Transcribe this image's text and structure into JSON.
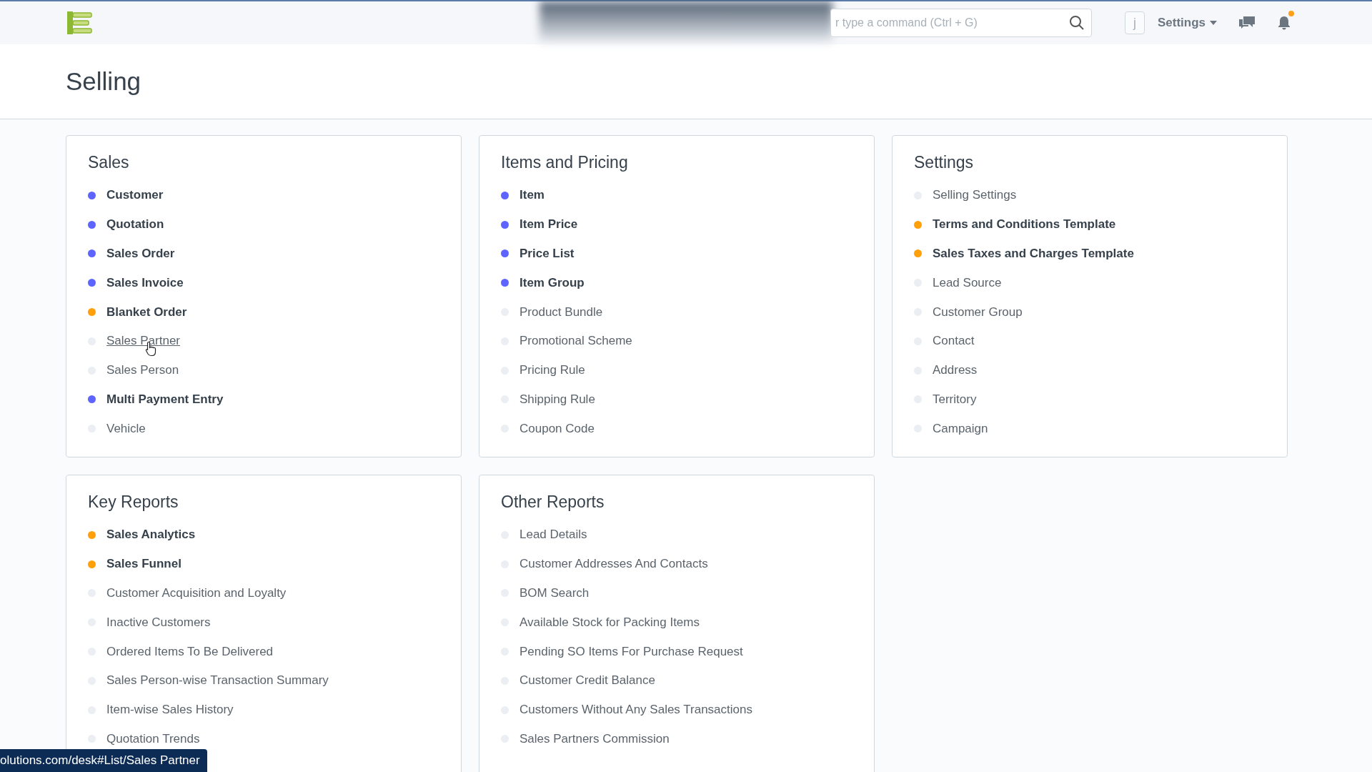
{
  "navbar": {
    "search": {
      "placeholder": "r type a command (Ctrl + G)"
    },
    "avatar": "j",
    "settings_label": "Settings",
    "notification_unread": true
  },
  "page": {
    "title": "Selling"
  },
  "cards": [
    {
      "title": "Sales",
      "items": [
        {
          "label": "Customer",
          "color": "#5e64ff",
          "bold": true,
          "hovered": false
        },
        {
          "label": "Quotation",
          "color": "#5e64ff",
          "bold": true,
          "hovered": false
        },
        {
          "label": "Sales Order",
          "color": "#5e64ff",
          "bold": true,
          "hovered": false
        },
        {
          "label": "Sales Invoice",
          "color": "#5e64ff",
          "bold": true,
          "hovered": false
        },
        {
          "label": "Blanket Order",
          "color": "#ffa00a",
          "bold": true,
          "hovered": false
        },
        {
          "label": "Sales Partner",
          "color": "#ebeef2",
          "bold": false,
          "hovered": true
        },
        {
          "label": "Sales Person",
          "color": "#ebeef2",
          "bold": false,
          "hovered": false
        },
        {
          "label": "Multi Payment Entry",
          "color": "#5e64ff",
          "bold": true,
          "hovered": false
        },
        {
          "label": "Vehicle",
          "color": "#ebeef2",
          "bold": false,
          "hovered": false
        }
      ]
    },
    {
      "title": "Items and Pricing",
      "items": [
        {
          "label": "Item",
          "color": "#5e64ff",
          "bold": true,
          "hovered": false
        },
        {
          "label": "Item Price",
          "color": "#5e64ff",
          "bold": true,
          "hovered": false
        },
        {
          "label": "Price List",
          "color": "#5e64ff",
          "bold": true,
          "hovered": false
        },
        {
          "label": "Item Group",
          "color": "#5e64ff",
          "bold": true,
          "hovered": false
        },
        {
          "label": "Product Bundle",
          "color": "#ebeef2",
          "bold": false,
          "hovered": false
        },
        {
          "label": "Promotional Scheme",
          "color": "#ebeef2",
          "bold": false,
          "hovered": false
        },
        {
          "label": "Pricing Rule",
          "color": "#ebeef2",
          "bold": false,
          "hovered": false
        },
        {
          "label": "Shipping Rule",
          "color": "#ebeef2",
          "bold": false,
          "hovered": false
        },
        {
          "label": "Coupon Code",
          "color": "#ebeef2",
          "bold": false,
          "hovered": false
        }
      ]
    },
    {
      "title": "Settings",
      "items": [
        {
          "label": "Selling Settings",
          "color": "#ebeef2",
          "bold": false,
          "hovered": false
        },
        {
          "label": "Terms and Conditions Template",
          "color": "#ffa00a",
          "bold": true,
          "hovered": false
        },
        {
          "label": "Sales Taxes and Charges Template",
          "color": "#ffa00a",
          "bold": true,
          "hovered": false
        },
        {
          "label": "Lead Source",
          "color": "#ebeef2",
          "bold": false,
          "hovered": false
        },
        {
          "label": "Customer Group",
          "color": "#ebeef2",
          "bold": false,
          "hovered": false
        },
        {
          "label": "Contact",
          "color": "#ebeef2",
          "bold": false,
          "hovered": false
        },
        {
          "label": "Address",
          "color": "#ebeef2",
          "bold": false,
          "hovered": false
        },
        {
          "label": "Territory",
          "color": "#ebeef2",
          "bold": false,
          "hovered": false
        },
        {
          "label": "Campaign",
          "color": "#ebeef2",
          "bold": false,
          "hovered": false
        }
      ]
    },
    {
      "title": "Key Reports",
      "items": [
        {
          "label": "Sales Analytics",
          "color": "#ffa00a",
          "bold": true,
          "hovered": false
        },
        {
          "label": "Sales Funnel",
          "color": "#ffa00a",
          "bold": true,
          "hovered": false
        },
        {
          "label": "Customer Acquisition and Loyalty",
          "color": "#ebeef2",
          "bold": false,
          "hovered": false
        },
        {
          "label": "Inactive Customers",
          "color": "#ebeef2",
          "bold": false,
          "hovered": false
        },
        {
          "label": "Ordered Items To Be Delivered",
          "color": "#ebeef2",
          "bold": false,
          "hovered": false
        },
        {
          "label": "Sales Person-wise Transaction Summary",
          "color": "#ebeef2",
          "bold": false,
          "hovered": false
        },
        {
          "label": "Item-wise Sales History",
          "color": "#ebeef2",
          "bold": false,
          "hovered": false
        },
        {
          "label": "Quotation Trends",
          "color": "#ebeef2",
          "bold": false,
          "hovered": false
        }
      ]
    },
    {
      "title": "Other Reports",
      "items": [
        {
          "label": "Lead Details",
          "color": "#ebeef2",
          "bold": false,
          "hovered": false
        },
        {
          "label": "Customer Addresses And Contacts",
          "color": "#ebeef2",
          "bold": false,
          "hovered": false
        },
        {
          "label": "BOM Search",
          "color": "#ebeef2",
          "bold": false,
          "hovered": false
        },
        {
          "label": "Available Stock for Packing Items",
          "color": "#ebeef2",
          "bold": false,
          "hovered": false
        },
        {
          "label": "Pending SO Items For Purchase Request",
          "color": "#ebeef2",
          "bold": false,
          "hovered": false
        },
        {
          "label": "Customer Credit Balance",
          "color": "#ebeef2",
          "bold": false,
          "hovered": false
        },
        {
          "label": "Customers Without Any Sales Transactions",
          "color": "#ebeef2",
          "bold": false,
          "hovered": false
        },
        {
          "label": "Sales Partners Commission",
          "color": "#ebeef2",
          "bold": false,
          "hovered": false
        }
      ]
    }
  ],
  "status_bar": {
    "url": "olutions.com/desk#List/Sales Partner"
  }
}
